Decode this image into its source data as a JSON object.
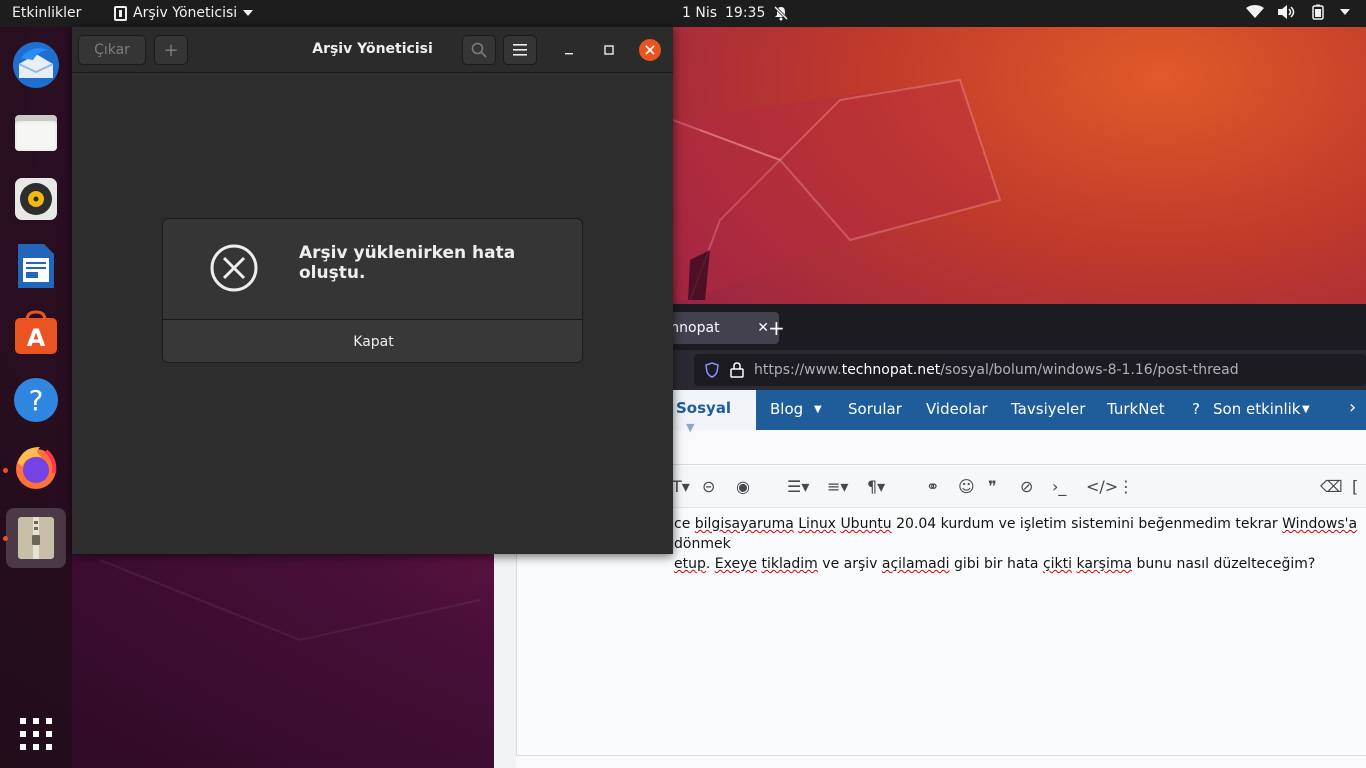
{
  "topbar": {
    "activities": "Etkinlikler",
    "app_name": "Arşiv Yöneticisi",
    "date": "1 Nis",
    "time": "19:35",
    "icons": [
      "bell-muted-icon",
      "wifi-icon",
      "volume-icon",
      "battery-icon",
      "power-menu-icon"
    ]
  },
  "dock": {
    "items": [
      "thunderbird-icon",
      "files-icon",
      "rhythmbox-icon",
      "libreoffice-writer-icon",
      "ubuntu-software-icon",
      "help-icon",
      "firefox-icon",
      "archive-manager-icon"
    ],
    "show_apps": "show-applications-icon"
  },
  "file_roller": {
    "extract_label": "Çıkar",
    "add_label": "+",
    "title": "Arşiv Yöneticisi"
  },
  "dialog": {
    "message": "Arşiv yüklenirken hata oluştu.",
    "close_label": "Kapat"
  },
  "browser": {
    "tab_title": "echnopat",
    "url_prefix": "https://www.",
    "url_host": "technopat.net",
    "url_path": "/sosyal/bolum/windows-8-1.16/post-thread",
    "nav": {
      "sosyal": "Sosyal",
      "blog": "Blog",
      "sorular": "Sorular",
      "videolar": "Videolar",
      "tavsiyeler": "Tavsiyeler",
      "turknet": "TurkNet",
      "son_etkinlik": "Son etkinlik"
    },
    "editor_line1_a": "ce ",
    "editor_line1_b": "bilgisayaruma",
    "editor_line1_c": " ",
    "editor_line1_d": "Linux",
    "editor_line1_e": " ",
    "editor_line1_f": "Ubuntu",
    "editor_line1_g": " 20.04 kurdum ve işletim sistemini beğenmedim tekrar ",
    "editor_line1_h": "Windows'a",
    "editor_line1_i": " dönmek",
    "editor_line2_a": "etup",
    "editor_line2_b": ". ",
    "editor_line2_c": "Exeye",
    "editor_line2_d": " ",
    "editor_line2_e": "tikladim",
    "editor_line2_f": " ve arşiv ",
    "editor_line2_g": "açilamadi",
    "editor_line2_h": " gibi bir hata ",
    "editor_line2_i": "çikti",
    "editor_line2_j": " ",
    "editor_line2_k": "karşima",
    "editor_line2_l": " bunu nasıl düzelteceğim?"
  },
  "colors": {
    "accent": "#e95420",
    "topbar": "#1d1d1d",
    "site_nav": "#1e5d99"
  }
}
